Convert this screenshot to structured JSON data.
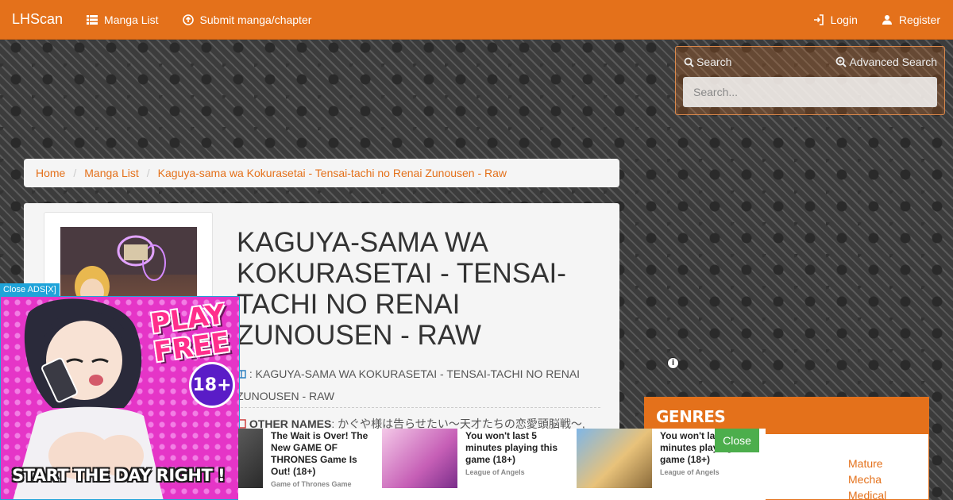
{
  "navbar": {
    "brand": "LHScan",
    "manga_list": "Manga List",
    "submit": "Submit manga/chapter",
    "login": "Login",
    "register": "Register"
  },
  "search": {
    "label": "Search",
    "advanced": "Advanced Search",
    "placeholder": "Search..."
  },
  "breadcrumb": {
    "home": "Home",
    "manga_list": "Manga List",
    "current": "Kaguya-sama wa Kokurasetai - Tensai-tachi no Renai Zunousen - Raw"
  },
  "manga": {
    "title": "KAGUYA-SAMA WA KOKURASETAI - TENSAI-TACHI NO RENAI ZUNOUSEN - RAW",
    "alt_title": ": KAGUYA-SAMA WA KOKURASETAI - TENSAI-TACHI NO RENAI ZUNOUSEN - RAW",
    "other_names_label": "OTHER NAMES",
    "other_names_value": ": かぐや様は告らせたい～天才たちの恋愛頭脳戦～,"
  },
  "genres": {
    "heading": "GENRES",
    "items": [
      "Mature",
      "Mecha",
      "Medical"
    ]
  },
  "ads": {
    "close_ads": "Close ADS[X]",
    "play_free": "PLAY FREE",
    "age": "18+",
    "start_text": "START THE DAY RIGHT !",
    "close": "Close",
    "strip": [
      {
        "headline": "The Wait is Over! The New GAME OF THRONES Game Is Out! (18+)",
        "source": "Game of Thrones Game"
      },
      {
        "headline": "You won't last 5 minutes playing this game (18+)",
        "source": "League of Angels"
      },
      {
        "headline": "You won't last 5 minutes playing this game (18+)",
        "source": "League of Angels"
      }
    ]
  },
  "colors": {
    "brand": "#e4711b",
    "ad_close": "#4cae4c",
    "ad_tab": "#1fa3d9"
  },
  "icons": [
    "list-icon",
    "upload-icon",
    "login-icon",
    "user-icon",
    "search-icon",
    "advanced-search-icon",
    "book-icon",
    "info-icon"
  ]
}
